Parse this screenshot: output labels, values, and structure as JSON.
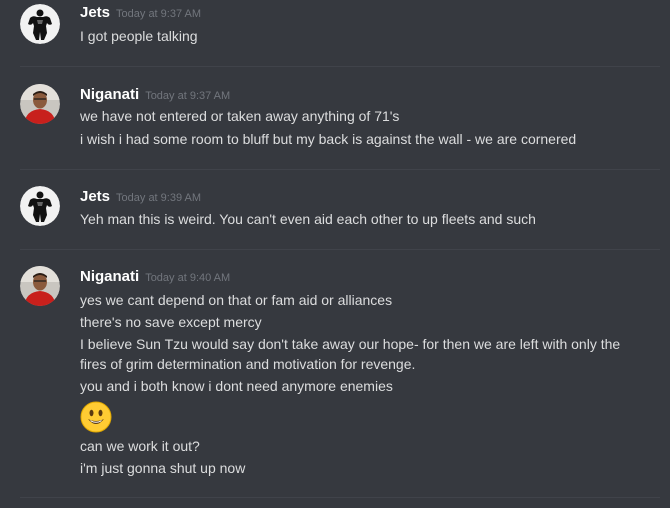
{
  "messages": [
    {
      "author": "Jets",
      "timestamp": "Today at 9:37 AM",
      "avatar_icon": "bodybuilder-avatar-icon",
      "lines": [
        "I got people talking"
      ]
    },
    {
      "author": "Niganati",
      "timestamp": "Today at 9:37 AM",
      "avatar_icon": "red-shirt-man-avatar-icon",
      "lines": [
        "we have not entered or taken away anything of 71's",
        "i wish i had some room to bluff but my back is against the wall - we are cornered"
      ]
    },
    {
      "author": "Jets",
      "timestamp": "Today at 9:39 AM",
      "avatar_icon": "bodybuilder-avatar-icon",
      "lines": [
        "Yeh man this is weird. You can't even aid each other to up fleets and such"
      ]
    },
    {
      "author": "Niganati",
      "timestamp": "Today at 9:40 AM",
      "avatar_icon": "red-shirt-man-avatar-icon",
      "lines": [
        "yes we cant depend on that or fam aid or alliances",
        "there's no save except mercy",
        "I believe Sun Tzu would say don't take away our hope- for then we are left with only the fires of grim determination and motivation for revenge.",
        "you and i both know i dont need anymore enemies",
        "can we work it out?",
        "i'm just gonna shut up now"
      ],
      "emoji": "smiley-emoji-icon"
    }
  ],
  "colors": {
    "background": "#36393f",
    "username": "#ffffff",
    "timestamp": "#72767d",
    "message_text": "#dcddde",
    "divider": "#40434a"
  }
}
